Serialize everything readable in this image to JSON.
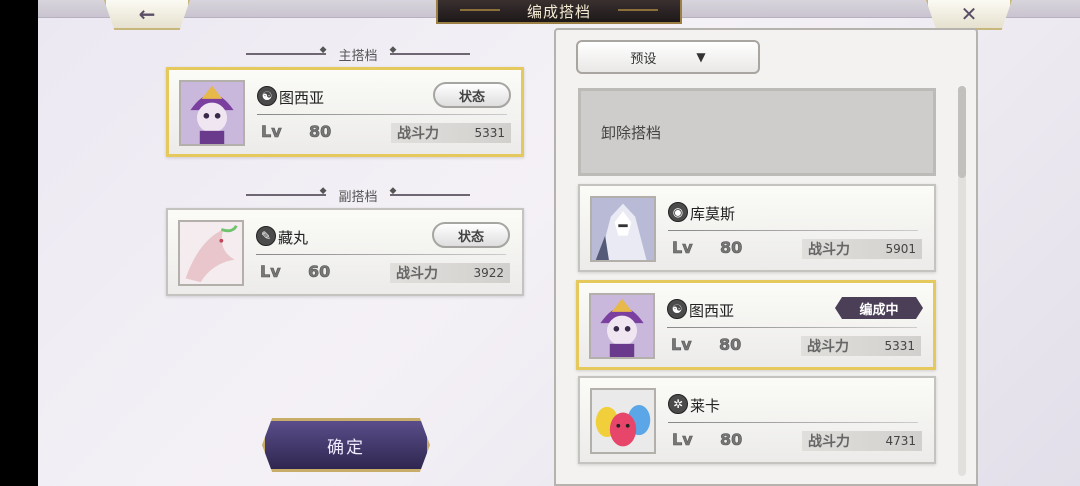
{
  "header": {
    "title": "编成搭档",
    "back_icon": "←",
    "close_icon": "✕"
  },
  "main_partner": {
    "section_label": "主搭档",
    "name": "图西亚",
    "element_icon": "☯",
    "status_label": "状态",
    "lv_label": "Lv",
    "level": "80",
    "power_label": "战斗力",
    "power": "5331"
  },
  "sub_partner": {
    "section_label": "副搭档",
    "name": "藏丸",
    "element_icon": "✎",
    "status_label": "状态",
    "lv_label": "Lv",
    "level": "60",
    "power_label": "战斗力",
    "power": "3922"
  },
  "confirm_label": "确定",
  "preset": {
    "label": "预设",
    "arrow": "▼"
  },
  "dismiss_label": "卸除搭档",
  "list": [
    {
      "name": "库莫斯",
      "element_icon": "◉",
      "lv_label": "Lv",
      "level": "80",
      "power_label": "战斗力",
      "power": "5901",
      "badge": ""
    },
    {
      "name": "图西亚",
      "element_icon": "☯",
      "lv_label": "Lv",
      "level": "80",
      "power_label": "战斗力",
      "power": "5331",
      "badge": "编成中"
    },
    {
      "name": "莱卡",
      "element_icon": "✲",
      "lv_label": "Lv",
      "level": "80",
      "power_label": "战斗力",
      "power": "4731",
      "badge": ""
    }
  ],
  "colors": {
    "selected_border": "#e6c95c",
    "accent_purple": "#4b3f57",
    "gold": "#c8ad6a"
  }
}
